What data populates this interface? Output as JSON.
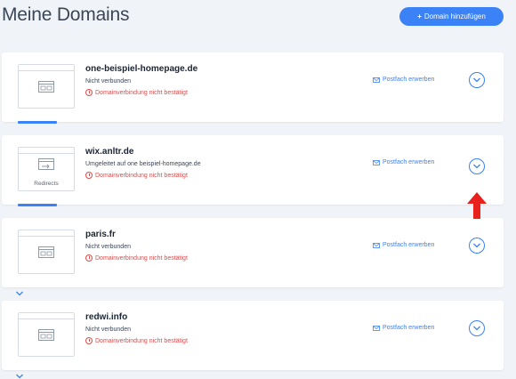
{
  "header": {
    "title": "Meine Domains",
    "add_button_label": "Domain hinzufügen",
    "add_button_icon": "plus-icon"
  },
  "colors": {
    "accent": "#3b82f6",
    "warning": "#e04b4b",
    "annotation_arrow": "#e8211d",
    "background": "#f0f3f7"
  },
  "domains": [
    {
      "name": "one-beispiel-homepage.de",
      "status": "Nicht verbunden",
      "warning": "Domainverbindung nicht bestätigt",
      "mailbox_link": "Postfach erwerben",
      "thumbnail_label": "",
      "expand_icon": "chevron-down-icon"
    },
    {
      "name": "wix.anltr.de",
      "status": "Umgeleitet auf one beispiel-homepage.de",
      "warning": "Domainverbindung nicht bestätigt",
      "mailbox_link": "Postfach erwerben",
      "thumbnail_label": "Redirects",
      "expand_icon": "chevron-down-icon"
    },
    {
      "name": "paris.fr",
      "status": "Nicht verbunden",
      "warning": "Domainverbindung nicht bestätigt",
      "mailbox_link": "Postfach erwerben",
      "thumbnail_label": "",
      "expand_icon": "chevron-down-icon"
    },
    {
      "name": "redwi.info",
      "status": "Nicht verbunden",
      "warning": "Domainverbindung nicht bestätigt",
      "mailbox_link": "Postfach erwerben",
      "thumbnail_label": "",
      "expand_icon": "chevron-down-icon"
    }
  ],
  "annotation": {
    "icon": "red-arrow-up-icon"
  }
}
